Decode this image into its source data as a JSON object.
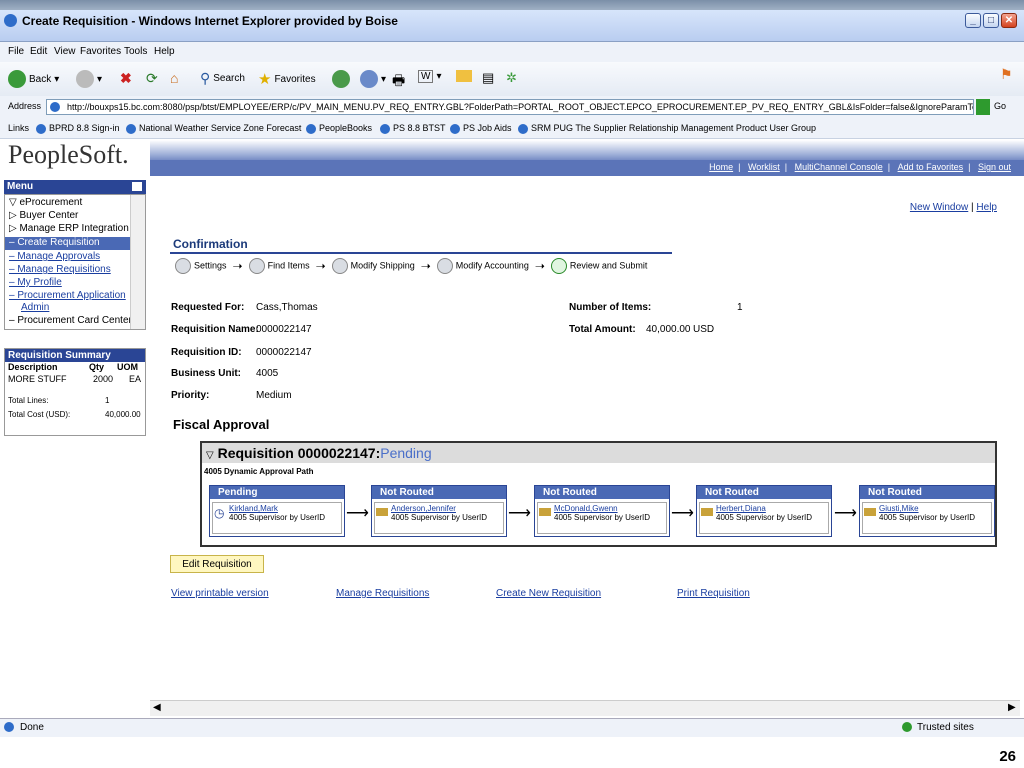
{
  "window": {
    "title": "Create Requisition - Windows Internet Explorer provided by Boise"
  },
  "menubar": [
    "File",
    "Edit",
    "View",
    "Favorites",
    "Tools",
    "Help"
  ],
  "toolbar": {
    "back": "Back",
    "search": "Search",
    "favorites": "Favorites"
  },
  "address": {
    "label": "Address",
    "url": "http://bouxps15.bc.com:8080/psp/btst/EMPLOYEE/ERP/c/PV_MAIN_MENU.PV_REQ_ENTRY.GBL?FolderPath=PORTAL_ROOT_OBJECT.EPCO_EPROCUREMENT.EP_PV_REQ_ENTRY_GBL&IsFolder=false&IgnoreParamTempl=FolderPath",
    "go": "Go"
  },
  "links": {
    "label": "Links",
    "items": [
      "BPRD 8.8 Sign-in",
      "National Weather Service Zone Forecast",
      "PeopleBooks",
      "PS 8.8 BTST",
      "PS Job Aids",
      "SRM PUG The Supplier Relationship Management Product User Group"
    ]
  },
  "brand": {
    "logo": "PeopleSoft."
  },
  "nav": {
    "links": [
      "Home",
      "Worklist",
      "MultiChannel Console",
      "Add to Favorites",
      "Sign out"
    ]
  },
  "top_links": {
    "new_window": "New Window",
    "help": "Help"
  },
  "menu": {
    "header": "Menu",
    "items": [
      {
        "label": "▽ eProcurement",
        "type": "plain"
      },
      {
        "label": "▷ Buyer Center",
        "type": "plain"
      },
      {
        "label": "▷ Manage ERP Integration",
        "type": "plain"
      },
      {
        "label": "– Create Requisition",
        "type": "selected"
      },
      {
        "label": "– Manage Approvals",
        "type": "link"
      },
      {
        "label": "– Manage Requisitions",
        "type": "link"
      },
      {
        "label": "– My Profile",
        "type": "link"
      },
      {
        "label": "– Procurement Application",
        "type": "link"
      },
      {
        "label": "Admin",
        "type": "link"
      },
      {
        "label": "– Procurement Card Center",
        "type": "plain"
      }
    ]
  },
  "req_summary": {
    "header": "Requisition Summary",
    "columns": [
      "Description",
      "Qty",
      "UOM"
    ],
    "row": [
      "MORE STUFF",
      "2000",
      "EA"
    ],
    "total_lines_label": "Total Lines:",
    "total_lines": "1",
    "total_cost_label": "Total Cost (USD):",
    "total_cost": "40,000.00"
  },
  "confirmation": {
    "title": "Confirmation",
    "steps": [
      "Settings",
      "Find Items",
      "Modify Shipping",
      "Modify Accounting",
      "Review and Submit"
    ]
  },
  "details": {
    "requested_for_label": "Requested For:",
    "requested_for": "Cass,Thomas",
    "req_name_label": "Requisition Name:",
    "req_name": "0000022147",
    "req_id_label": "Requisition ID:",
    "req_id": "0000022147",
    "bu_label": "Business Unit:",
    "bu": "4005",
    "priority_label": "Priority:",
    "priority": "Medium",
    "num_items_label": "Number of Items:",
    "num_items": "1",
    "total_amount_label": "Total Amount:",
    "total_amount": "40,000.00",
    "currency": "USD"
  },
  "fiscal": {
    "title": "Fiscal Approval",
    "req_title": "Requisition 0000022147:",
    "req_status": "Pending",
    "path": "4005 Dynamic Approval Path",
    "stages": [
      {
        "status": "Pending",
        "name": "Kirkland,Mark",
        "role": "4005 Supervisor by UserID"
      },
      {
        "status": "Not Routed",
        "name": "Anderson,Jennifer",
        "role": "4005 Supervisor by UserID"
      },
      {
        "status": "Not Routed",
        "name": "McDonald,Gwenn",
        "role": "4005 Supervisor by UserID"
      },
      {
        "status": "Not Routed",
        "name": "Herbert,Diana",
        "role": "4005 Supervisor by UserID"
      },
      {
        "status": "Not Routed",
        "name": "Giusti,Mike",
        "role": "4005 Supervisor by UserID"
      }
    ]
  },
  "actions": {
    "edit": "Edit Requisition",
    "links": [
      "View printable version",
      "Manage Requisitions",
      "Create New Requisition",
      "Print Requisition"
    ]
  },
  "status": {
    "left": "Done",
    "zone": "Trusted sites"
  },
  "slide_number": "26"
}
